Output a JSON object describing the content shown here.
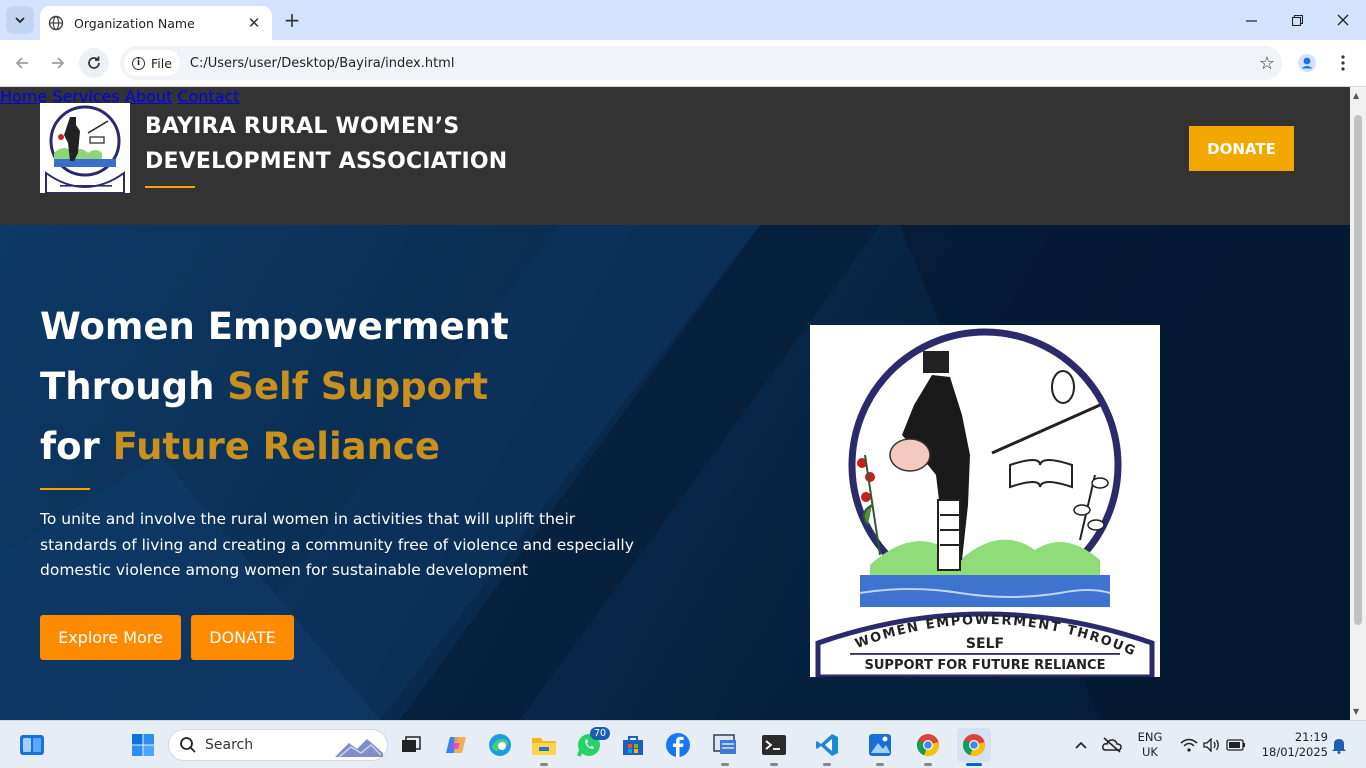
{
  "browser": {
    "tab_title": "Organization Name",
    "new_tab": "+",
    "file_chip": "File",
    "url": "C:/Users/user/Desktop/Bayira/index.html"
  },
  "site": {
    "brand_line1": "BAYIRA RURAL WOMEN’S",
    "brand_line2": "DEVELOPMENT ASSOCIATION",
    "nav": [
      "Home",
      "Services",
      "About",
      "Contact"
    ],
    "donate_top": "DONATE"
  },
  "hero": {
    "line1": "Women Empowerment",
    "line2_a": "Through ",
    "line2_b": "Self Support",
    "line3_a": "for ",
    "line3_b": "Future Reliance",
    "text": "To unite and involve the rural women in activities that will uplift their standards of living and creating a community free of violence and especially domestic violence among women for sustainable development",
    "explore": "Explore More",
    "donate": "DONATE"
  },
  "logo": {
    "ring_text": "WOMEN EMPOWERMENT THROUGH",
    "line_self": "SELF",
    "line_support": "SUPPORT FOR FUTURE RELIANCE"
  },
  "taskbar": {
    "search": "Search",
    "whatsapp_badge": "70",
    "lang": "ENG",
    "region": "UK",
    "time": "21:19",
    "date": "18/01/2025"
  },
  "colors": {
    "accent_gold": "#c9901e",
    "donate_yellow": "#f2a800",
    "button_orange": "#ff8c00",
    "header_bg": "#333333",
    "hero_bg": "#072544"
  }
}
